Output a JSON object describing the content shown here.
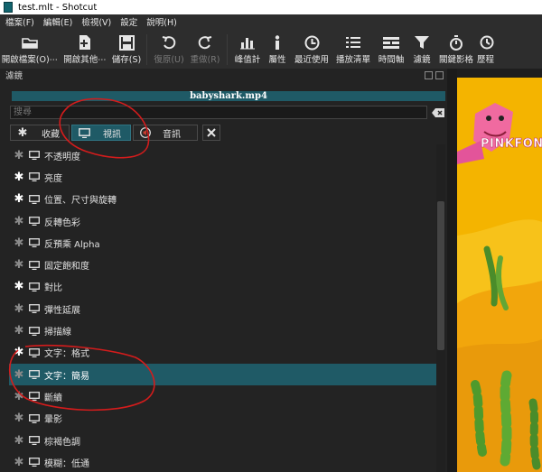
{
  "window": {
    "title": "test.mlt - Shotcut"
  },
  "menu": [
    "檔案(F)",
    "編輯(E)",
    "檢視(V)",
    "設定",
    "說明(H)"
  ],
  "toolbar": {
    "open": "開啟檔案(O)⋯",
    "open_other": "開啟其他⋯",
    "save": "儲存(S)",
    "undo": "復原(U)",
    "redo": "重做(R)",
    "peak": "峰值計",
    "properties": "屬性",
    "recent": "最近使用",
    "playlist": "播放清單",
    "timeline": "時間軸",
    "filters": "濾鏡",
    "keyframes": "關鍵影格",
    "history": "歷程"
  },
  "panel": {
    "title": "濾鏡",
    "clip_name": "babyshark.mp4",
    "search_placeholder": "搜尋",
    "tabs": {
      "favorites": "收藏",
      "video": "視訊",
      "audio": "音訊"
    }
  },
  "filters": [
    {
      "label": "不透明度",
      "favorite": false
    },
    {
      "label": "亮度",
      "favorite": true
    },
    {
      "label": "位置、尺寸與旋轉",
      "favorite": true
    },
    {
      "label": "反轉色彩",
      "favorite": false
    },
    {
      "label": "反預乘 Alpha",
      "favorite": false
    },
    {
      "label": "固定飽和度",
      "favorite": false
    },
    {
      "label": "對比",
      "favorite": true
    },
    {
      "label": "彈性延展",
      "favorite": false
    },
    {
      "label": "掃描線",
      "favorite": false
    },
    {
      "label": "文字：格式",
      "favorite": true
    },
    {
      "label": "文字：簡易",
      "favorite": false,
      "selected": true
    },
    {
      "label": "斷續",
      "favorite": false
    },
    {
      "label": "暈影",
      "favorite": false
    },
    {
      "label": "棕褐色調",
      "favorite": false
    },
    {
      "label": "模糊：低通",
      "favorite": false
    }
  ],
  "preview": {
    "logo_text": "PINKFON"
  },
  "colors": {
    "accent": "#1f5a66",
    "annotation": "#d41c1c",
    "preview_bg": "#f7c21a"
  }
}
